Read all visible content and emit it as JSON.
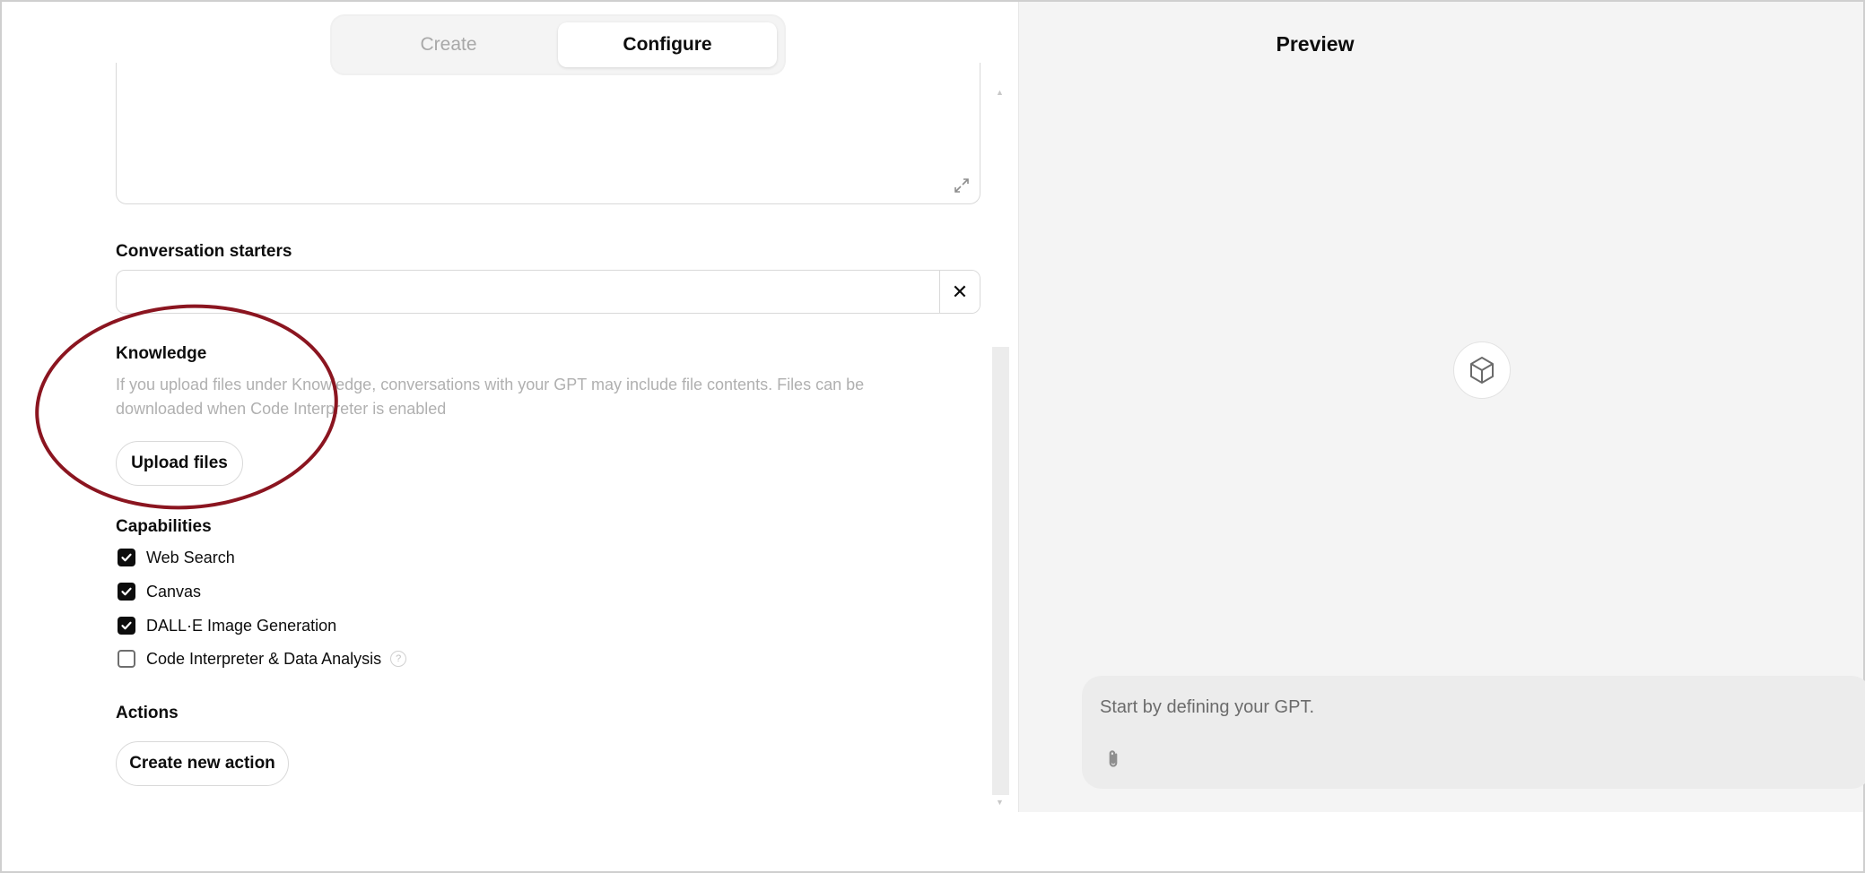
{
  "tabs": {
    "create": "Create",
    "configure": "Configure"
  },
  "preview": {
    "title": "Preview",
    "composer_placeholder": "Start by defining your GPT."
  },
  "conversation_starters": {
    "label": "Conversation starters",
    "value": "",
    "clear_symbol": "✕"
  },
  "knowledge": {
    "label": "Knowledge",
    "description": "If you upload files under Knowledge, conversations with your GPT may include file contents. Files can be downloaded when Code Interpreter is enabled",
    "upload_button": "Upload files"
  },
  "capabilities": {
    "label": "Capabilities",
    "items": [
      {
        "label": "Web Search",
        "checked": true
      },
      {
        "label": "Canvas",
        "checked": true
      },
      {
        "label": "DALL·E Image Generation",
        "checked": true
      },
      {
        "label": "Code Interpreter & Data Analysis",
        "checked": false
      }
    ],
    "info_symbol": "?"
  },
  "actions": {
    "label": "Actions",
    "create_button": "Create new action"
  },
  "icons": {
    "expand": "expand-icon",
    "close": "close-icon",
    "check": "checkmark-icon",
    "info": "info-icon",
    "gpt": "cube-icon",
    "attach": "paperclip-icon"
  },
  "colors": {
    "annotation": "#8b1520",
    "preview_bg": "#f4f4f4",
    "composer_bg": "#ececec"
  }
}
